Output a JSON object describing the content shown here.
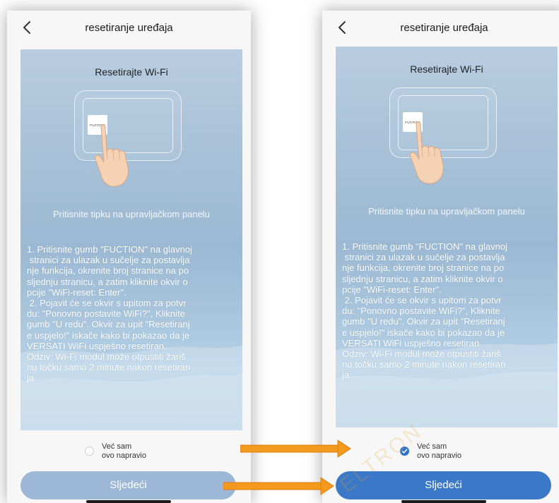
{
  "screens": [
    {
      "nav": {
        "title": "resetiranje uređaja"
      },
      "card": {
        "title": "Resetirajte Wi-Fi",
        "key_label": "FUCTION",
        "hint": "Pritisnite tipku na upravljačkom panelu",
        "instructions": "1. Pritisnite gumb \"FUCTION\" na glavnoj\n stranici za ulazak u sučelje za postavlja\nnje funkcija, okrenite broj stranice na po\nsljednju stranicu, a zatim kliknite okvir o\npcije \"WiFi-reset: Enter\".\n 2. Pojavit će se okvir s upitom za potvr\ndu: \"Ponovno postavite WiFi?\", Kliknite\ngumb \"U redu\". Okvir za upit \"Resetiranj\ne uspjelo!\" iskače kako bi pokazao da je\nVERSATI WiFi uspješno resetiran.\nOdziv: Wi-Fi modul može otpustiti žariš\nnu točku samo 2 minute nakon resetiran\nja"
      },
      "confirm": {
        "label_line1": "Već sam",
        "label_line2": "ovo napravio",
        "checked": false
      },
      "next_button": {
        "label": "Sljedeći",
        "enabled": false
      }
    },
    {
      "nav": {
        "title": "resetiranje uređaja"
      },
      "card": {
        "title": "Resetirajte Wi-Fi",
        "key_label": "FUCTION",
        "hint": "Pritisnite tipku na upravljačkom panelu",
        "instructions": "1. Pritisnite gumb \"FUCTION\" na glavnoj\n stranici za ulazak u sučelje za postavlja\nnje funkcija, okrenite broj stranice na po\nsljednju stranicu, a zatim kliknite okvir o\npcije \"WiFi-reset: Enter\".\n 2. Pojavit će se okvir s upitom za potvr\ndu: \"Ponovno postavite WiFi?\", Kliknite\ngumb \"U redu\". Okvir za upit \"Resetiranj\ne uspjelo!\" iskače kako bi pokazao da je\nVERSATI WiFi uspješno resetiran.\nOdziv: Wi-Fi modul može otpustiti žariš\nnu točku samo 2 minute nakon resetiran\nja"
      },
      "confirm": {
        "label_line1": "Već sam",
        "label_line2": "ovo napravio",
        "checked": true
      },
      "next_button": {
        "label": "Sljedeći",
        "enabled": true
      }
    }
  ],
  "icons": {
    "back": "chevron-left-icon",
    "hand": "pointing-hand-icon",
    "check": "checkmark-icon",
    "arrow": "arrow-right-icon"
  },
  "colors": {
    "accent_blue": "#3b79c8",
    "disabled_blue": "#9db7d6",
    "arrow_orange": "#f39a1e"
  },
  "watermark": "ELTRON"
}
